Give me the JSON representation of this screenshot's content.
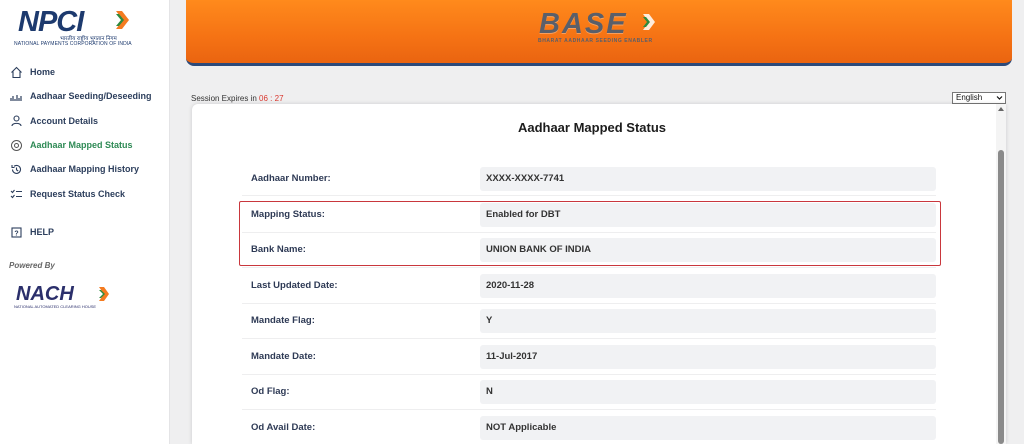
{
  "sidebar": {
    "logo": {
      "text": "NPCI",
      "subtitle_hindi": "भारतीय राष्ट्रीय भुगतान निगम",
      "subtitle": "NATIONAL PAYMENTS CORPORATION OF INDIA"
    },
    "items": [
      {
        "label": "Home",
        "icon": "home-icon"
      },
      {
        "label": "Aadhaar Seeding/Deseeding",
        "icon": "seeding-icon"
      },
      {
        "label": "Account Details",
        "icon": "user-icon"
      },
      {
        "label": "Aadhaar Mapped Status",
        "icon": "target-icon",
        "active": true
      },
      {
        "label": "Aadhaar Mapping History",
        "icon": "history-icon"
      },
      {
        "label": "Request Status Check",
        "icon": "status-check-icon"
      }
    ],
    "help": {
      "label": "HELP",
      "icon": "help-icon"
    },
    "powered_by": "Powered By",
    "nach_logo": {
      "text": "NACH",
      "subtitle": "NATIONAL AUTOMATED CLEARING HOUSE"
    }
  },
  "header": {
    "logo": {
      "text": "BASE",
      "subtitle": "BHARAT AADHAAR SEEDING ENABLER"
    }
  },
  "session": {
    "label": "Session Expires in",
    "timer": "06 : 27"
  },
  "language": {
    "selected": "English"
  },
  "card": {
    "title": "Aadhaar Mapped Status",
    "rows": [
      {
        "label": "Aadhaar Number:",
        "value": "XXXX-XXXX-7741"
      },
      {
        "label": "Mapping Status:",
        "value": "Enabled for DBT"
      },
      {
        "label": "Bank Name:",
        "value": "UNION BANK OF INDIA"
      },
      {
        "label": "Last Updated Date:",
        "value": "2020-11-28"
      },
      {
        "label": "Mandate Flag:",
        "value": "Y"
      },
      {
        "label": "Mandate Date:",
        "value": "11-Jul-2017"
      },
      {
        "label": "Od Flag:",
        "value": "N"
      },
      {
        "label": "Od Avail Date:",
        "value": "NOT Applicable"
      }
    ]
  },
  "colors": {
    "banner_orange": "#f57214",
    "active_nav": "#2e8a55",
    "highlight_border": "#c9373d",
    "timer": "#d9372e",
    "navy": "#1d3a6e"
  }
}
